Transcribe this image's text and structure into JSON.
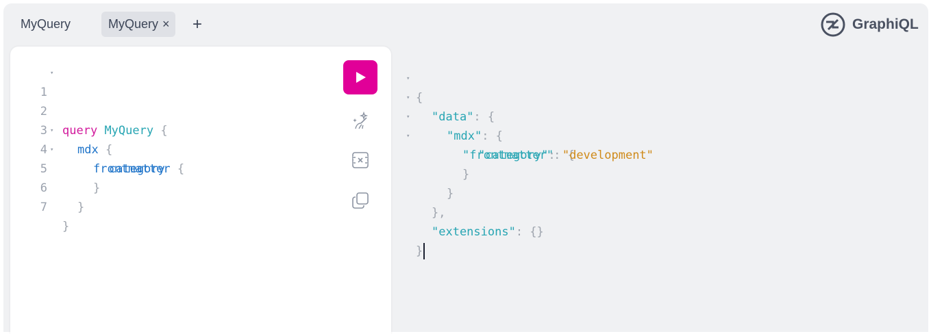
{
  "tabs": [
    {
      "label": "MyQuery",
      "active": false
    },
    {
      "label": "MyQuery",
      "active": true,
      "close_icon": "×"
    }
  ],
  "add_tab_label": "+",
  "brand": {
    "title": "GraphiQL",
    "logo_icon": "graphiql-logo-icon"
  },
  "editor": {
    "line_numbers": [
      "1",
      "2",
      "3",
      "4",
      "5",
      "6",
      "7"
    ],
    "fold_marker": "▾",
    "tokens": {
      "l1_kw": "query",
      "l1_name": "MyQuery",
      "l1_brace": "{",
      "l2_field": "mdx",
      "l2_brace": "{",
      "l3_field": "frontmatter",
      "l3_brace": "{",
      "l4_field": "category",
      "l5_brace": "}",
      "l6_brace": "}",
      "l7_brace": "}"
    },
    "toolbar": {
      "run_icon": "play-icon",
      "prettify_icon": "prettify-icon",
      "merge_icon": "merge-fragments-icon",
      "copy_icon": "copy-icon"
    }
  },
  "result": {
    "fold_marker": "▾",
    "tokens": {
      "r1": "{",
      "r2_key": "\"data\"",
      "r2_rest": ": {",
      "r3_key": "\"mdx\"",
      "r3_rest": ": {",
      "r4_key": "\"frontmatter\"",
      "r4_rest": ": {",
      "r5_key": "\"category\"",
      "r5_colon": ": ",
      "r5_val": "\"development\"",
      "r6": "}",
      "r7": "}",
      "r8": "},",
      "r9_key": "\"extensions\"",
      "r9_rest": ": {}",
      "r10": "}"
    }
  },
  "colors": {
    "keyword": "#d2199c",
    "definition": "#27a5b3",
    "field": "#1f74c9",
    "string": "#cf8a19",
    "run_button": "#e10098"
  }
}
